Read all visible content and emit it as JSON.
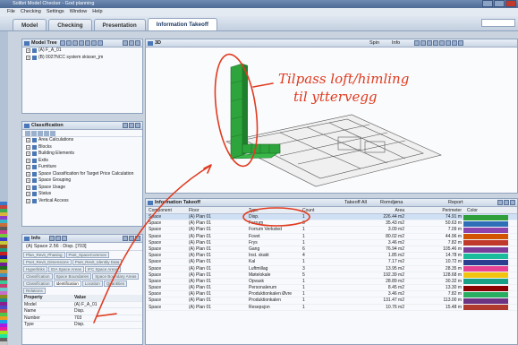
{
  "window": {
    "title": "Solibri Model Checker - God planning"
  },
  "menu": [
    "File",
    "Checking",
    "Settings",
    "Window",
    "Help"
  ],
  "tabs": [
    {
      "label": "Model",
      "active": false
    },
    {
      "label": "Checking",
      "active": false
    },
    {
      "label": "Presentation",
      "active": false
    },
    {
      "label": "Information Takeoff",
      "active": true
    }
  ],
  "model_tree": {
    "title": "Model Tree",
    "items": [
      {
        "label": "(A) F_A_01"
      },
      {
        "label": "(B) 0027NCC system skisser_jm"
      }
    ]
  },
  "view3d": {
    "title": "3D",
    "toolbar": {
      "spin": "Spin",
      "info": "Info"
    }
  },
  "classification": {
    "title": "Classification",
    "items": [
      "Area Calculations",
      "Blocks",
      "Building Elements",
      "Exits",
      "Furniture",
      "Space Classification for Target Price Calculation",
      "Space Grouping",
      "Space Usage",
      "Status",
      "Vertical Access"
    ]
  },
  "info_panel": {
    "title": "Info",
    "subject": "(A) Space 2.56 : Disp. [703]",
    "tabs_row1": [
      "Plan_Revit_Phasing",
      "Pset_SpaceCommon"
    ],
    "tabs_row2": [
      "Pset_Revit_Dimensions",
      "Pset_Revit_Identity Data"
    ],
    "tabs_row3": [
      "Hyperlinks",
      "IDA Space Areas",
      "IFC Space Areas",
      "Classification"
    ],
    "tabs_row4": [
      "Space Boundaries",
      "Space Boundary Areas",
      "Classification"
    ],
    "tabs_row5": [
      "Identification",
      "Location",
      "Quantities",
      "Relations"
    ],
    "columns": [
      "Property",
      "Value"
    ],
    "rows": [
      {
        "k": "Model",
        "v": "(A) F_A_01"
      },
      {
        "k": "Name",
        "v": "Disp."
      },
      {
        "k": "Number",
        "v": "703"
      },
      {
        "k": "Type",
        "v": "Disp."
      }
    ]
  },
  "takeoff": {
    "title": "Information Takeoff",
    "toolbar": {
      "all": "Takeoff All",
      "select": "Romdjøna",
      "report": "Report"
    },
    "columns": [
      "Component",
      "Floor",
      "Type",
      "Count",
      "Area",
      "Perimeter",
      "Color"
    ],
    "rows": [
      {
        "component": "Space",
        "floor": "(A) Plan 01",
        "type": "Disp.",
        "count": "1",
        "area": "226.44 m2",
        "perimeter": "74.91 m",
        "color": "#2e9f3a"
      },
      {
        "component": "Space",
        "floor": "(A) Plan 01",
        "type": "Forrum",
        "count": "3",
        "area": "35.43 m2",
        "perimeter": "50.63 m",
        "color": "#2f6fb8"
      },
      {
        "component": "Space",
        "floor": "(A) Plan 01",
        "type": "Forrum Verksted",
        "count": "1",
        "area": "3.09 m2",
        "perimeter": "7.09 m",
        "color": "#8e44ad"
      },
      {
        "component": "Space",
        "floor": "(A) Plan 01",
        "type": "Fovet",
        "count": "1",
        "area": "80.02 m2",
        "perimeter": "44.96 m",
        "color": "#d35400"
      },
      {
        "component": "Space",
        "floor": "(A) Plan 01",
        "type": "Frys",
        "count": "1",
        "area": "3.46 m2",
        "perimeter": "7.82 m",
        "color": "#c0392b"
      },
      {
        "component": "Space",
        "floor": "(A) Plan 01",
        "type": "Gang",
        "count": "6",
        "area": "76.94 m2",
        "perimeter": "105.46 m",
        "color": "#7d3c98"
      },
      {
        "component": "Space",
        "floor": "(A) Plan 01",
        "type": "Inst. skakt",
        "count": "4",
        "area": "1.85 m2",
        "perimeter": "14.78 m",
        "color": "#1abc9c"
      },
      {
        "component": "Space",
        "floor": "(A) Plan 01",
        "type": "Kal",
        "count": "1",
        "area": "7.17 m2",
        "perimeter": "10.72 m",
        "color": "#2c3e90"
      },
      {
        "component": "Space",
        "floor": "(A) Plan 01",
        "type": "Luftmillag",
        "count": "3",
        "area": "13.95 m2",
        "perimeter": "28.35 m",
        "color": "#e84393"
      },
      {
        "component": "Space",
        "floor": "(A) Plan 01",
        "type": "Møtelokale",
        "count": "5",
        "area": "192.39 m2",
        "perimeter": "128.68 m",
        "color": "#f1c40f"
      },
      {
        "component": "Space",
        "floor": "(A) Plan 01",
        "type": "Opvask",
        "count": "1",
        "area": "28.89 m2",
        "perimeter": "30.32 m",
        "color": "#16a085"
      },
      {
        "component": "Space",
        "floor": "(A) Plan 01",
        "type": "Personalerum",
        "count": "1",
        "area": "8.45 m2",
        "perimeter": "13.30 m",
        "color": "#8b0000"
      },
      {
        "component": "Space",
        "floor": "(A) Plan 01",
        "type": "Produktionkalen Øvre",
        "count": "1",
        "area": "3.46 m2",
        "perimeter": "7.82 m",
        "color": "#27ae60"
      },
      {
        "component": "Space",
        "floor": "(A) Plan 01",
        "type": "Produktionkalen",
        "count": "1",
        "area": "131.47 m2",
        "perimeter": "113.00 m",
        "color": "#6c3483"
      },
      {
        "component": "Space",
        "floor": "(A) Plan 01",
        "type": "Resepsjon",
        "count": "1",
        "area": "10.76 m2",
        "perimeter": "15.48 m",
        "color": "#b03a2e"
      }
    ]
  },
  "annotation": {
    "line1": "Tilpass loft/himling",
    "line2": "til yttervegg"
  },
  "palette": [
    "#3c78c8",
    "#c8413c",
    "#3ca85a",
    "#d8b43c",
    "#8c3cc8",
    "#3cb4c8",
    "#c86e3c",
    "#5a5a5a",
    "#c83c96",
    "#78c83c",
    "#3c3cc8",
    "#c8c83c",
    "#964b1e",
    "#1e967d",
    "#c81e1e",
    "#1e1e96",
    "#96c81e",
    "#6e1e96",
    "#1e6e1e",
    "#c8963c",
    "#3c96c8",
    "#963c3c",
    "#3cc896",
    "#c83c6e",
    "#6ec8c8",
    "#c86ec8",
    "#8c8c1e",
    "#1e8c8c",
    "#8c1e8c",
    "#4b4bc8",
    "#c84b4b",
    "#4bc84b",
    "#e6a01e",
    "#1ea0e6",
    "#a01ee6",
    "#e61ea0",
    "#a0e61e",
    "#1ee6a0",
    "#646464",
    "#c8c8c8",
    "#c83c3c",
    "#3c6ec8",
    "#6ec83c",
    "#c8aa3c",
    "#8c3c8c",
    "#3c8c8c",
    "#b45a1e",
    "#1e5ab4",
    "#5ab41e",
    "#b41e5a"
  ]
}
